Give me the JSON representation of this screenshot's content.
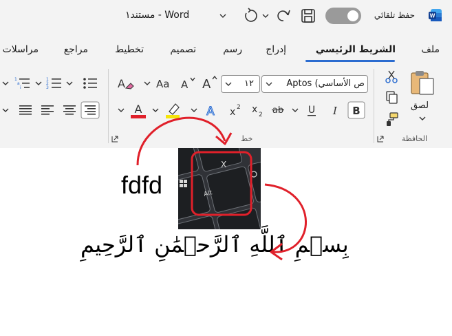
{
  "app": {
    "autosave_label": "حفظ تلقائي",
    "doc_title": "Word  -  مستند١"
  },
  "tabs": [
    {
      "label": "ملف"
    },
    {
      "label": "الشريط الرئيسي"
    },
    {
      "label": "إدراج"
    },
    {
      "label": "رسم"
    },
    {
      "label": "تصميم"
    },
    {
      "label": "تخطيط"
    },
    {
      "label": "مراجع"
    },
    {
      "label": "مراسلات"
    }
  ],
  "ribbon": {
    "font_name": "ص الأساسي) Aptos",
    "font_size": "١٢",
    "paste_label": "لصق",
    "clipboard_label": "الحافظة",
    "font_group_label": "خط"
  },
  "document": {
    "text": "fdfd",
    "bismillah": "بِسۡمِ ٱللَّهِ ٱلرَّحۡمَٰنِ ٱلرَّحِيمِ",
    "key_x": "X",
    "key_alt": "Alt"
  },
  "colors": {
    "accent": "#2b6cd0",
    "annotation": "#e0202a",
    "font_color": "#e0202a",
    "highlight": "#f5e50a"
  }
}
